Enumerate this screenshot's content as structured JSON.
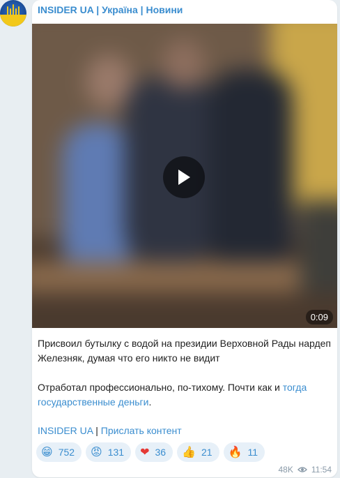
{
  "channel": {
    "name": "INSIDER UA | Україна | Новини"
  },
  "video": {
    "duration": "0:09"
  },
  "post": {
    "paragraph1": "Присвоил бутылку с водой на президии Верховной Рады нардеп Железняк, думая что его никто не видит",
    "paragraph2_prefix": "Отработал профессионально, по-тихому. Почти как и ",
    "paragraph2_link": "тогда государственные деньги",
    "paragraph2_suffix": ".",
    "footer_link1": "INSIDER UA",
    "footer_separator": " | ",
    "footer_link2": "Прислать контент"
  },
  "reactions": [
    {
      "emoji": "😁",
      "count": "752",
      "icon": "grin-emoji"
    },
    {
      "emoji": "😡",
      "count": "131",
      "icon": "angry-emoji"
    },
    {
      "emoji": "❤",
      "count": "36",
      "icon": "heart-emoji"
    },
    {
      "emoji": "👍",
      "count": "21",
      "icon": "thumbs-up-emoji"
    },
    {
      "emoji": "🔥",
      "count": "11",
      "icon": "fire-emoji"
    }
  ],
  "meta": {
    "views": "48K",
    "time": "11:54",
    "views_icon": "eye-icon"
  },
  "colors": {
    "accent": "#3a8dcf",
    "reaction_bg": "#e7f0f8",
    "page_bg": "#e8eef2"
  }
}
